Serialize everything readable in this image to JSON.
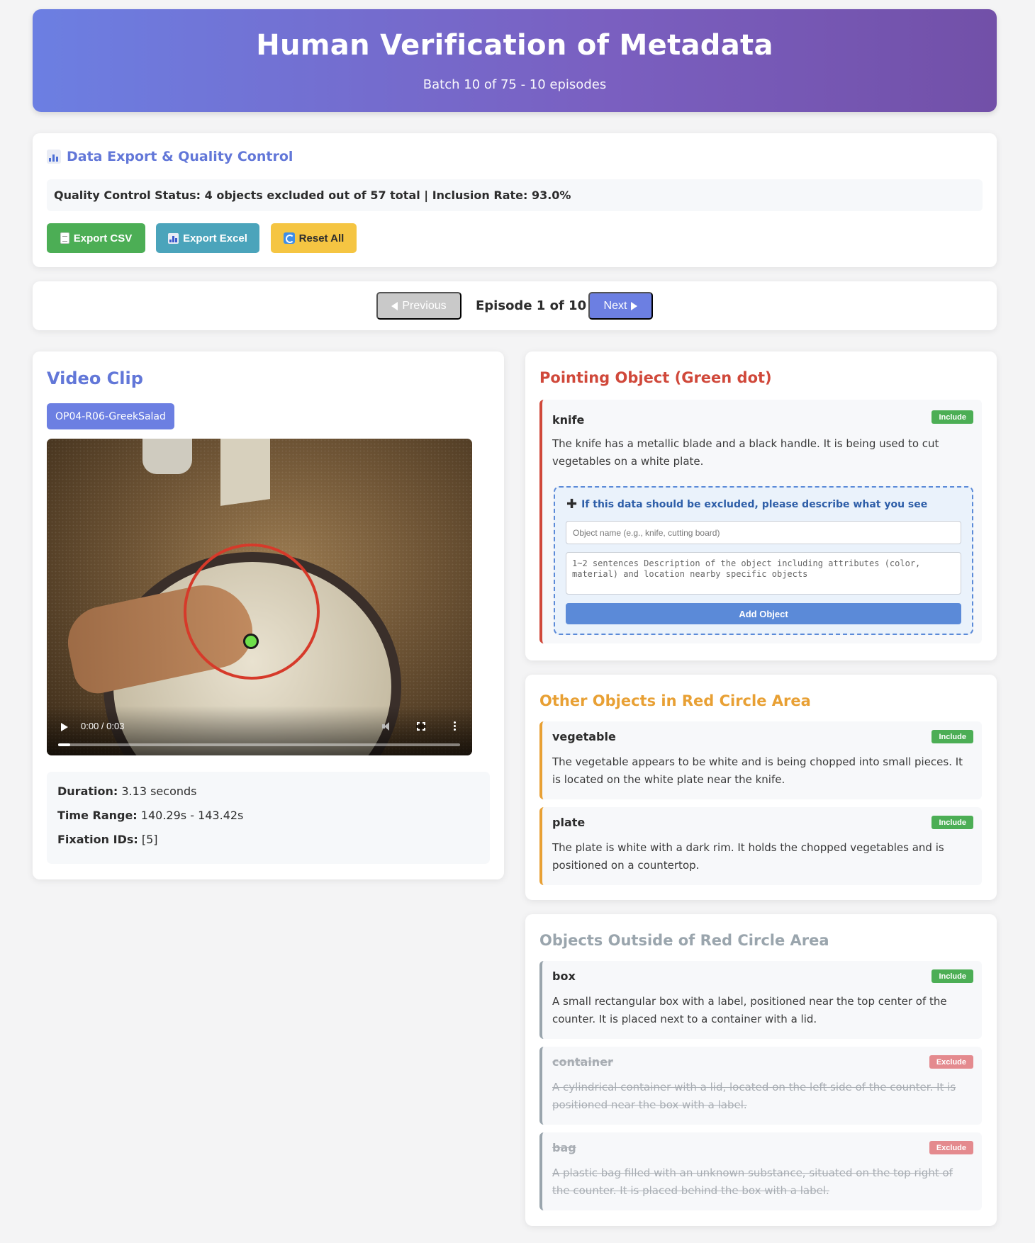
{
  "header": {
    "title": "Human Verification of Metadata",
    "subtitle": "Batch 10 of 75 - 10 episodes"
  },
  "export": {
    "title": "Data Export & Quality Control",
    "qc_status": "Quality Control Status: 4 objects excluded out of 57 total | Inclusion Rate: 93.0%",
    "buttons": {
      "csv": "Export CSV",
      "excel": "Export Excel",
      "reset": "Reset All"
    }
  },
  "navigation": {
    "previous": "Previous",
    "label": "Episode 1 of 10",
    "next": "Next"
  },
  "video": {
    "title": "Video Clip",
    "clip_id": "OP04-R06-GreekSalad",
    "time_display": "0:00 / 0:03",
    "progress_fraction": 0.03,
    "duration_label": "Duration:",
    "duration_value": "3.13 seconds",
    "time_range_label": "Time Range:",
    "time_range_value": "140.29s - 143.42s",
    "fixation_label": "Fixation IDs:",
    "fixation_value": "[5]"
  },
  "pointing": {
    "title": "Pointing Object (Green dot)",
    "color": "#d0483a",
    "object": {
      "name": "knife",
      "badge": "Include",
      "description": "The knife has a metallic blade and a black handle. It is being used to cut vegetables on a white plate."
    },
    "exclude_form": {
      "title": "If this data should be excluded, please describe what you see",
      "name_placeholder": "Object name (e.g., knife, cutting board)",
      "description_placeholder": "1~2 sentences Description of the object including attributes (color, material) and location nearby specific objects",
      "button": "Add Object"
    }
  },
  "other": {
    "title": "Other Objects in Red Circle Area",
    "color": "#e8a034",
    "objects": [
      {
        "name": "vegetable",
        "badge": "Include",
        "description": "The vegetable appears to be white and is being chopped into small pieces. It is located on the white plate near the knife."
      },
      {
        "name": "plate",
        "badge": "Include",
        "description": "The plate is white with a dark rim. It holds the chopped vegetables and is positioned on a countertop."
      }
    ]
  },
  "outside": {
    "title": "Objects Outside of Red Circle Area",
    "color": "#9aa5ad",
    "objects": [
      {
        "name": "box",
        "badge": "Include",
        "description": "A small rectangular box with a label, positioned near the top center of the counter. It is placed next to a container with a lid."
      },
      {
        "name": "container",
        "badge": "Exclude",
        "description": "A cylindrical container with a lid, located on the left side of the counter. It is positioned near the box with a label."
      },
      {
        "name": "bag",
        "badge": "Exclude",
        "description": "A plastic bag filled with an unknown substance, situated on the top right of the counter. It is placed behind the box with a label."
      }
    ]
  }
}
